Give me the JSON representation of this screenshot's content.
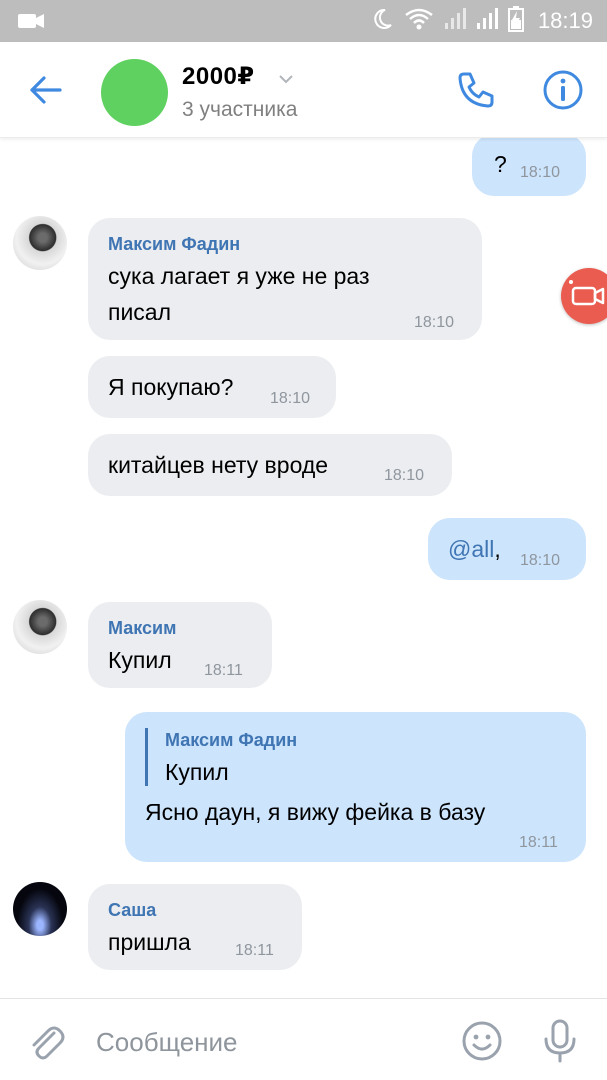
{
  "status_bar": {
    "time": "18:19"
  },
  "header": {
    "title": "2000₽",
    "subtitle": "3 участника",
    "avatar_color": "#5fd160",
    "accent_color": "#3f8ae0"
  },
  "messages": [
    {
      "dir": "out",
      "text": "?",
      "time": "18:10"
    },
    {
      "dir": "in",
      "sender": "Максим Фадин",
      "text_line1": "сука лагает я уже не раз",
      "text_line2": "писал",
      "time": "18:10"
    },
    {
      "dir": "in",
      "text": "Я покупаю?",
      "time": "18:10"
    },
    {
      "dir": "in",
      "text": "китайцев нету вроде",
      "time": "18:10"
    },
    {
      "dir": "out",
      "mention": "@all",
      "text": ",",
      "time": "18:10"
    },
    {
      "dir": "in",
      "sender": "Максим",
      "text": "Купил",
      "time": "18:11"
    },
    {
      "dir": "out",
      "reply_sender": "Максим Фадин",
      "reply_text": "Купил",
      "text": "Ясно даун, я вижу фейка в базу",
      "time": "18:11"
    },
    {
      "dir": "in",
      "sender": "Саша",
      "text": "пришла",
      "time": "18:11"
    }
  ],
  "composer": {
    "placeholder": "Сообщение"
  }
}
